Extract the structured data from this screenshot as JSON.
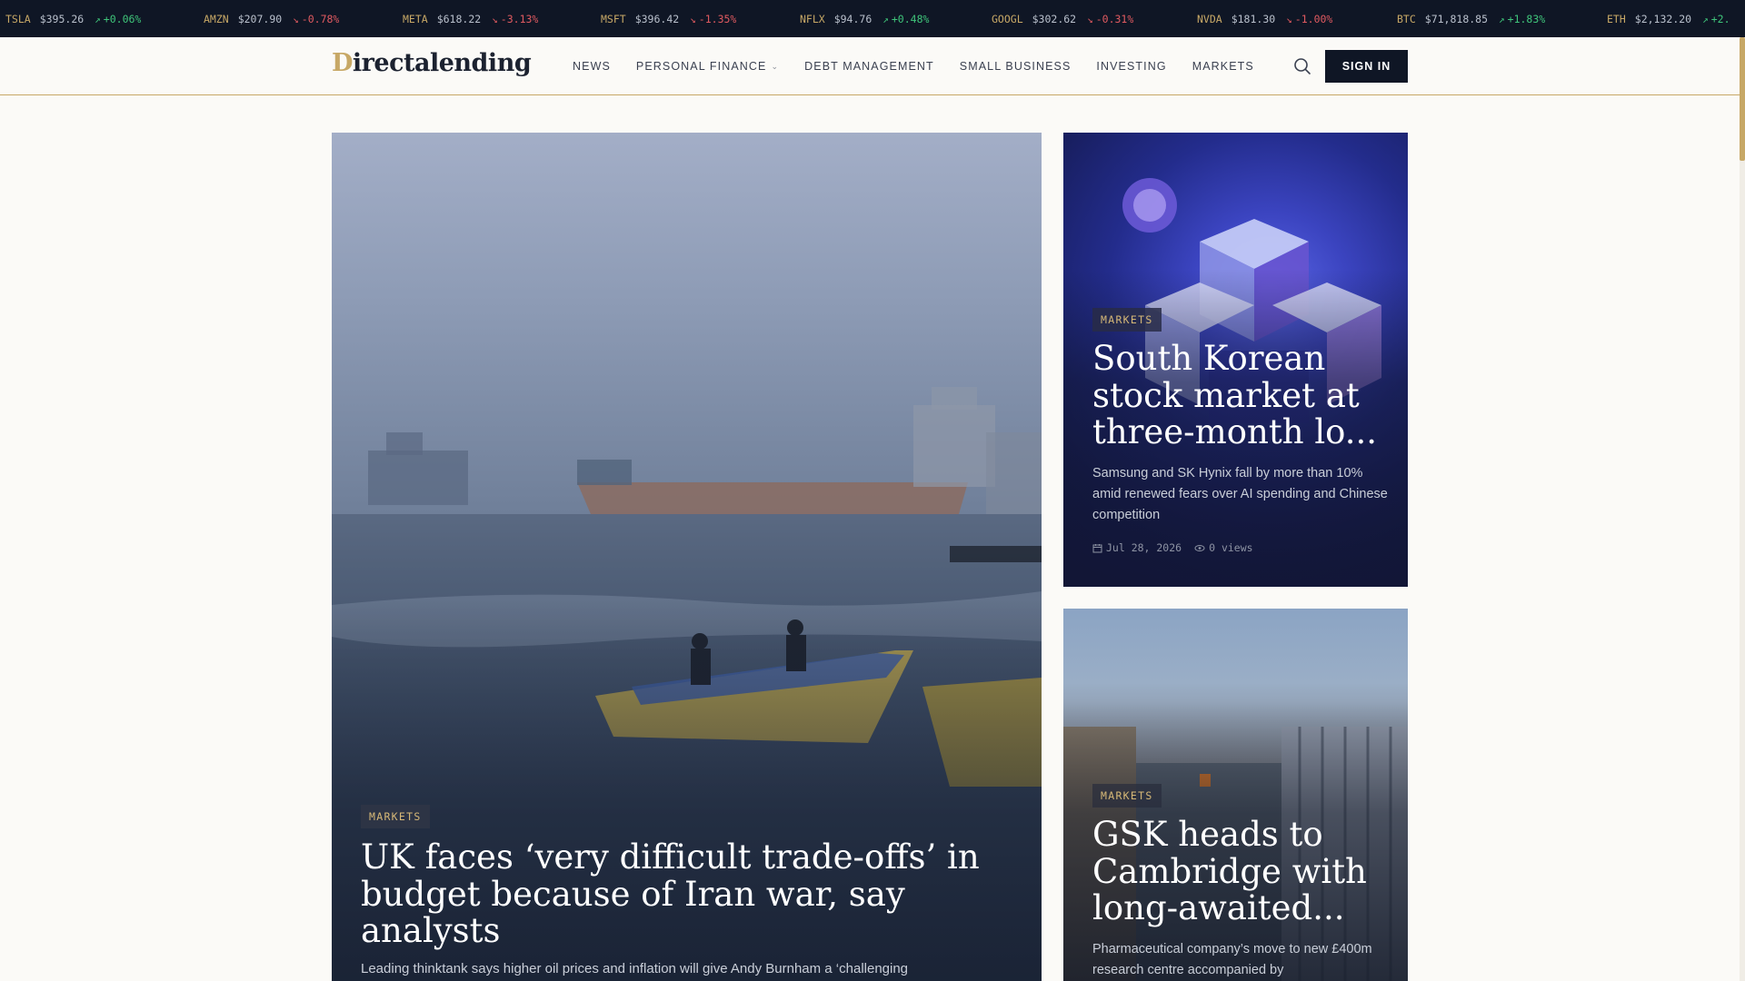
{
  "ticker": [
    {
      "symbol": "TSLA",
      "price": "$395.26",
      "change": "+0.06%",
      "direction": "up"
    },
    {
      "symbol": "AMZN",
      "price": "$207.90",
      "change": "-0.78%",
      "direction": "down"
    },
    {
      "symbol": "META",
      "price": "$618.22",
      "change": "-3.13%",
      "direction": "down"
    },
    {
      "symbol": "MSFT",
      "price": "$396.42",
      "change": "-1.35%",
      "direction": "down"
    },
    {
      "symbol": "NFLX",
      "price": "$94.76",
      "change": "+0.48%",
      "direction": "up"
    },
    {
      "symbol": "GOOGL",
      "price": "$302.62",
      "change": "-0.31%",
      "direction": "down"
    },
    {
      "symbol": "NVDA",
      "price": "$181.30",
      "change": "-1.00%",
      "direction": "down"
    },
    {
      "symbol": "BTC",
      "price": "$71,818.85",
      "change": "+1.83%",
      "direction": "up"
    },
    {
      "symbol": "ETH",
      "price": "$2,132.20",
      "change": "+2.",
      "direction": "up"
    }
  ],
  "header": {
    "logo_first": "D",
    "logo_rest": "irectalending",
    "nav": {
      "news": "NEWS",
      "personal_finance": "PERSONAL FINANCE",
      "debt_management": "DEBT MANAGEMENT",
      "small_business": "SMALL BUSINESS",
      "investing": "INVESTING",
      "markets": "MARKETS"
    },
    "sign_in": "SIGN IN"
  },
  "main_article": {
    "category": "MARKETS",
    "title": "UK faces ‘very difficult trade-offs’ in budget because of Iran war, say analysts",
    "description": "Leading thinktank says higher oil prices and inflation will give Andy Burnham a ‘challenging"
  },
  "side_articles": [
    {
      "category": "MARKETS",
      "title": "South Korean stock market at three-month lo...",
      "description": "Samsung and SK Hynix fall by more than 10% amid renewed fears over AI spending and Chinese competition",
      "date": "Jul 28, 2026",
      "views": "0 views"
    },
    {
      "category": "MARKETS",
      "title": "GSK heads to Cambridge with long-awaited...",
      "description": "Pharmaceutical company’s move to new £400m research centre accompanied by"
    }
  ],
  "colors": {
    "accent": "#c7a866",
    "navy": "#0f1625",
    "up": "#3fc57a",
    "down": "#e05a60"
  }
}
